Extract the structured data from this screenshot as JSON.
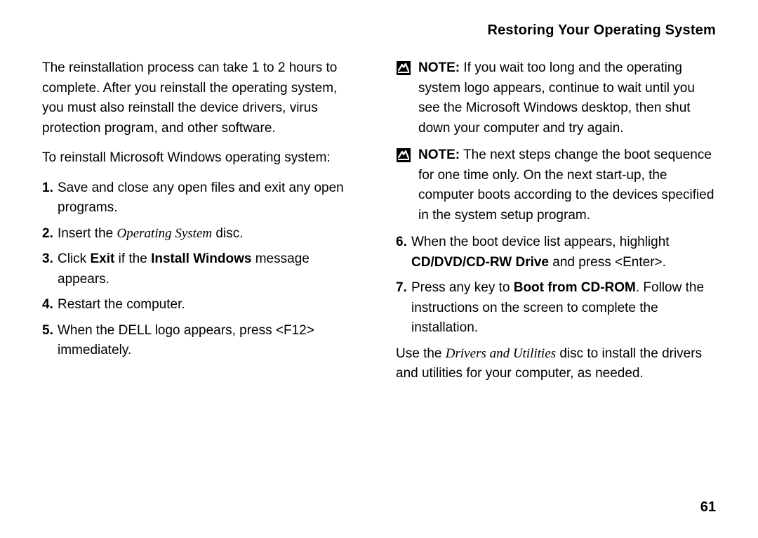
{
  "header": "Restoring Your Operating System",
  "page_number": "61",
  "left": {
    "intro": "The reinstallation process can take 1 to 2 hours to complete. After you reinstall the operating system, you must also reinstall the device drivers, virus protection program, and other software.",
    "lead_in": "To reinstall Microsoft Windows operating system:",
    "steps": {
      "s1_num": "1.",
      "s1": "Save and close any open files and exit any open programs.",
      "s2_num": "2.",
      "s2_a": "Insert the ",
      "s2_i": "Operating System",
      "s2_b": " disc.",
      "s3_num": "3.",
      "s3_a": "Click ",
      "s3_bold1": "Exit",
      "s3_b": " if the ",
      "s3_bold2": "Install Windows",
      "s3_c": " message appears.",
      "s4_num": "4.",
      "s4": "Restart the computer.",
      "s5_num": "5.",
      "s5": "When the DELL logo appears, press <F12> immediately."
    }
  },
  "right": {
    "note1_label": "NOTE:",
    "note1": " If you wait too long and the operating system logo appears, continue to wait until you see the Microsoft Windows desktop, then shut down your computer and try again.",
    "note2_label": "NOTE:",
    "note2": " The next steps change the boot sequence for one time only. On the next start-up, the computer boots according to the devices specified in the system setup program.",
    "steps": {
      "s6_num": "6.",
      "s6_a": "When the boot device list appears, highlight ",
      "s6_bold": "CD/DVD/CD-RW Drive",
      "s6_b": " and press <Enter>.",
      "s7_num": "7.",
      "s7_a": "Press any key to ",
      "s7_bold": "Boot from CD-ROM",
      "s7_b": ". Follow the instructions on the screen to complete the installation."
    },
    "closing_a": "Use the ",
    "closing_i": "Drivers and Utilities",
    "closing_b": " disc to install the drivers and utilities for your computer, as needed."
  }
}
